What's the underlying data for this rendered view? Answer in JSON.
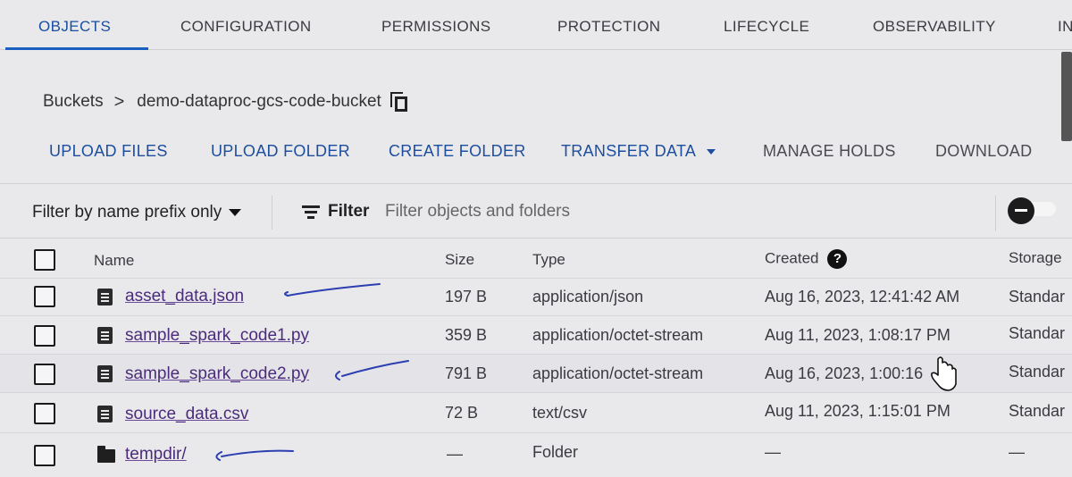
{
  "tabs": [
    {
      "label": "OBJECTS",
      "active": true
    },
    {
      "label": "CONFIGURATION"
    },
    {
      "label": "PERMISSIONS"
    },
    {
      "label": "PROTECTION"
    },
    {
      "label": "LIFECYCLE"
    },
    {
      "label": "OBSERVABILITY"
    },
    {
      "label": "IN"
    }
  ],
  "breadcrumb": {
    "root": "Buckets",
    "bucket": "demo-dataproc-gcs-code-bucket",
    "copy_icon": "copy-icon"
  },
  "actions": {
    "upload_files": "UPLOAD FILES",
    "upload_folder": "UPLOAD FOLDER",
    "create_folder": "CREATE FOLDER",
    "transfer_data": "TRANSFER DATA",
    "manage_holds": "MANAGE HOLDS",
    "download": "DOWNLOAD"
  },
  "filter": {
    "prefix_label": "Filter by name prefix only",
    "filter_label": "Filter",
    "placeholder": "Filter objects and folders"
  },
  "table": {
    "headers": {
      "name": "Name",
      "size": "Size",
      "type": "Type",
      "created": "Created",
      "storage": "Storage"
    },
    "rows": [
      {
        "name": "asset_data.json",
        "size": "197 B",
        "type": "application/json",
        "created": "Aug 16, 2023, 12:41:42 AM",
        "storage": "Standar",
        "icon": "file-icon"
      },
      {
        "name": "sample_spark_code1.py",
        "size": "359 B",
        "type": "application/octet-stream",
        "created": "Aug 11, 2023, 1:08:17 PM",
        "storage": "Standar",
        "icon": "file-icon"
      },
      {
        "name": "sample_spark_code2.py",
        "size": "791 B",
        "type": "application/octet-stream",
        "created": "Aug 16, 2023, 1:00:16",
        "storage": "Standar",
        "icon": "file-icon"
      },
      {
        "name": "source_data.csv",
        "size": "72 B",
        "type": "text/csv",
        "created": "Aug 11, 2023, 1:15:01 PM",
        "storage": "Standar",
        "icon": "file-icon"
      },
      {
        "name": "tempdir/",
        "size": "—",
        "type": "Folder",
        "created": "—",
        "storage": "—",
        "icon": "folder-icon"
      }
    ]
  },
  "colors": {
    "accent": "#1a5fc0",
    "link": "#4a2c7a",
    "annotation_ink": "#2c3fb0"
  }
}
